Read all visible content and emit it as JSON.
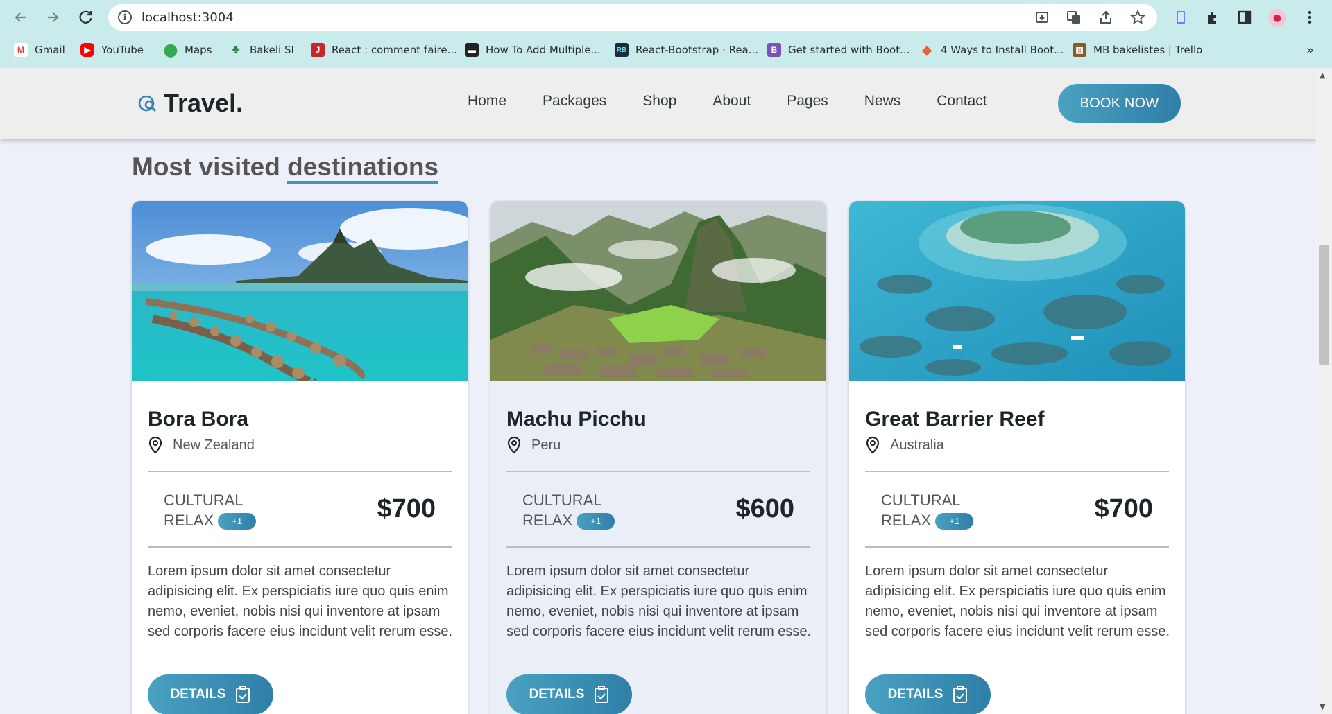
{
  "browser": {
    "url": "localhost:3004",
    "bookmarks": [
      {
        "label": "Gmail",
        "icon": "gmail-icon",
        "color": "#ea4335"
      },
      {
        "label": "YouTube",
        "icon": "youtube-icon",
        "color": "#ff0000"
      },
      {
        "label": "Maps",
        "icon": "maps-icon",
        "color": "#34a853"
      },
      {
        "label": "Bakeli SI",
        "icon": "bakeli-icon",
        "color": "#2d7d46"
      },
      {
        "label": "React : comment faire...",
        "icon": "j-icon",
        "color": "#c9252c"
      },
      {
        "label": "How To Add Multiple...",
        "icon": "page-icon",
        "color": "#222222"
      },
      {
        "label": "React-Bootstrap · Rea...",
        "icon": "rb-icon",
        "color": "#1a2b3c"
      },
      {
        "label": "Get started with Boot...",
        "icon": "bootstrap-icon",
        "color": "#7952b3"
      },
      {
        "label": "4 Ways to Install Boot...",
        "icon": "diamond-icon",
        "color": "#e8622c"
      },
      {
        "label": "MB bakelistes | Trello",
        "icon": "trello-icon",
        "color": "#8a5a2b"
      }
    ]
  },
  "header": {
    "logo": "Travel.",
    "menu": [
      "Home",
      "Packages",
      "Shop",
      "About",
      "Pages",
      "News",
      "Contact"
    ],
    "book_label": "BOOK NOW"
  },
  "section": {
    "title_plain": "Most visited ",
    "title_underlined": "destinations"
  },
  "cards": [
    {
      "title": "Bora Bora",
      "location": "New Zealand",
      "tag1": "CULTURAL",
      "tag2": "RELAX",
      "extra": "+1",
      "price": "$700",
      "description": "Lorem ipsum dolor sit amet consectetur adipisicing elit. Ex perspiciatis iure quo quis enim nemo, eveniet, nobis nisi qui inventore at ipsam sed corporis facere eius incidunt velit rerum esse.",
      "button": "DETAILS"
    },
    {
      "title": "Machu Picchu",
      "location": "Peru",
      "tag1": "CULTURAL",
      "tag2": "RELAX",
      "extra": "+1",
      "price": "$600",
      "description": "Lorem ipsum dolor sit amet consectetur adipisicing elit. Ex perspiciatis iure quo quis enim nemo, eveniet, nobis nisi qui inventore at ipsam sed corporis facere eius incidunt velit rerum esse.",
      "button": "DETAILS"
    },
    {
      "title": "Great Barrier Reef",
      "location": "Australia",
      "tag1": "CULTURAL",
      "tag2": "RELAX",
      "extra": "+1",
      "price": "$700",
      "description": "Lorem ipsum dolor sit amet consectetur adipisicing elit. Ex perspiciatis iure quo quis enim nemo, eveniet, nobis nisi qui inventore at ipsam sed corporis facere eius incidunt velit rerum esse.",
      "button": "DETAILS"
    }
  ],
  "colors": {
    "accent": "#3f95b7",
    "chrome": "#c9ebeb",
    "page_bg": "#eef0f9"
  }
}
